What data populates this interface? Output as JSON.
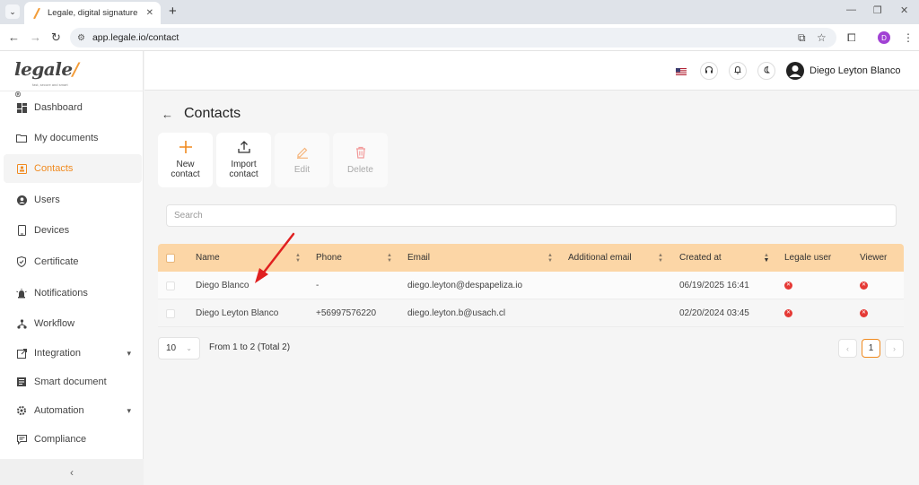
{
  "browser": {
    "tab_title": "Legale, digital signature",
    "url": "app.legale.io/contact",
    "profile_initial": "D"
  },
  "logo": {
    "word": "legale",
    "mark": "/",
    "registered": "®",
    "tagline": "fast, secure and smart"
  },
  "sidebar": {
    "items": [
      {
        "label": "Dashboard",
        "icon": "dashboard-icon"
      },
      {
        "label": "My documents",
        "icon": "folder-icon"
      },
      {
        "label": "Contacts",
        "icon": "contacts-icon",
        "active": true
      },
      {
        "label": "Users",
        "icon": "user-icon"
      },
      {
        "label": "Devices",
        "icon": "device-icon"
      },
      {
        "label": "Certificate",
        "icon": "shield-icon"
      },
      {
        "label": "Notifications",
        "icon": "alert-icon"
      },
      {
        "label": "Workflow",
        "icon": "workflow-icon"
      },
      {
        "label": "Integration",
        "icon": "integration-icon",
        "expandable": true
      },
      {
        "label": "Smart document",
        "icon": "smart-document-icon"
      },
      {
        "label": "Automation",
        "icon": "automation-icon",
        "expandable": true
      },
      {
        "label": "Compliance",
        "icon": "compliance-icon"
      }
    ],
    "collapse_glyph": "‹"
  },
  "header": {
    "user_name": "Diego Leyton Blanco"
  },
  "page": {
    "title": "Contacts",
    "actions": {
      "new": {
        "line1": "New",
        "line2": "contact"
      },
      "import": {
        "line1": "Import",
        "line2": "contact"
      },
      "edit": {
        "label": "Edit"
      },
      "delete": {
        "label": "Delete"
      }
    },
    "search_placeholder": "Search"
  },
  "table": {
    "columns": {
      "name": "Name",
      "phone": "Phone",
      "email": "Email",
      "additional_email": "Additional email",
      "created_at": "Created at",
      "legale_user": "Legale user",
      "viewer": "Viewer"
    },
    "rows": [
      {
        "name": "Diego Blanco",
        "phone": "-",
        "email": "diego.leyton@despapeliza.io",
        "additional_email": "",
        "created_at": "06/19/2025 16:41",
        "legale_user": false,
        "viewer": false
      },
      {
        "name": "Diego Leyton Blanco",
        "phone": "+56997576220",
        "email": "diego.leyton.b@usach.cl",
        "additional_email": "",
        "created_at": "02/20/2024 03:45",
        "legale_user": false,
        "viewer": false
      }
    ]
  },
  "pagination": {
    "page_size": "10",
    "info": "From 1 to 2 (Total 2)",
    "current_page": "1",
    "prev": "‹",
    "next": "›"
  },
  "colors": {
    "accent": "#f08a1f",
    "table_header": "#fcd6a6",
    "status_false": "#e53935",
    "annotation_arrow": "#e02020"
  }
}
